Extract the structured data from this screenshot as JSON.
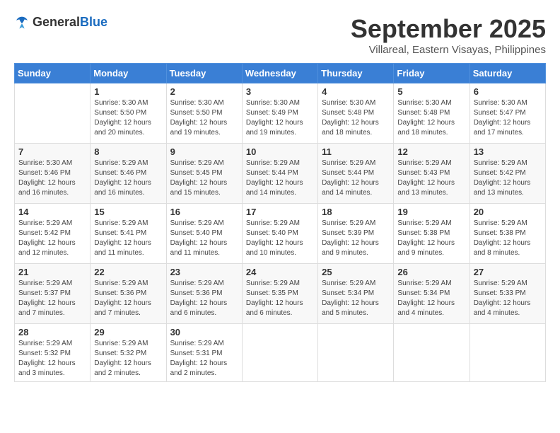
{
  "logo": {
    "text_general": "General",
    "text_blue": "Blue"
  },
  "header": {
    "month": "September 2025",
    "location": "Villareal, Eastern Visayas, Philippines"
  },
  "weekdays": [
    "Sunday",
    "Monday",
    "Tuesday",
    "Wednesday",
    "Thursday",
    "Friday",
    "Saturday"
  ],
  "weeks": [
    [
      {
        "day": "",
        "sunrise": "",
        "sunset": "",
        "daylight": ""
      },
      {
        "day": "1",
        "sunrise": "Sunrise: 5:30 AM",
        "sunset": "Sunset: 5:50 PM",
        "daylight": "Daylight: 12 hours and 20 minutes."
      },
      {
        "day": "2",
        "sunrise": "Sunrise: 5:30 AM",
        "sunset": "Sunset: 5:50 PM",
        "daylight": "Daylight: 12 hours and 19 minutes."
      },
      {
        "day": "3",
        "sunrise": "Sunrise: 5:30 AM",
        "sunset": "Sunset: 5:49 PM",
        "daylight": "Daylight: 12 hours and 19 minutes."
      },
      {
        "day": "4",
        "sunrise": "Sunrise: 5:30 AM",
        "sunset": "Sunset: 5:48 PM",
        "daylight": "Daylight: 12 hours and 18 minutes."
      },
      {
        "day": "5",
        "sunrise": "Sunrise: 5:30 AM",
        "sunset": "Sunset: 5:48 PM",
        "daylight": "Daylight: 12 hours and 18 minutes."
      },
      {
        "day": "6",
        "sunrise": "Sunrise: 5:30 AM",
        "sunset": "Sunset: 5:47 PM",
        "daylight": "Daylight: 12 hours and 17 minutes."
      }
    ],
    [
      {
        "day": "7",
        "sunrise": "Sunrise: 5:30 AM",
        "sunset": "Sunset: 5:46 PM",
        "daylight": "Daylight: 12 hours and 16 minutes."
      },
      {
        "day": "8",
        "sunrise": "Sunrise: 5:29 AM",
        "sunset": "Sunset: 5:46 PM",
        "daylight": "Daylight: 12 hours and 16 minutes."
      },
      {
        "day": "9",
        "sunrise": "Sunrise: 5:29 AM",
        "sunset": "Sunset: 5:45 PM",
        "daylight": "Daylight: 12 hours and 15 minutes."
      },
      {
        "day": "10",
        "sunrise": "Sunrise: 5:29 AM",
        "sunset": "Sunset: 5:44 PM",
        "daylight": "Daylight: 12 hours and 14 minutes."
      },
      {
        "day": "11",
        "sunrise": "Sunrise: 5:29 AM",
        "sunset": "Sunset: 5:44 PM",
        "daylight": "Daylight: 12 hours and 14 minutes."
      },
      {
        "day": "12",
        "sunrise": "Sunrise: 5:29 AM",
        "sunset": "Sunset: 5:43 PM",
        "daylight": "Daylight: 12 hours and 13 minutes."
      },
      {
        "day": "13",
        "sunrise": "Sunrise: 5:29 AM",
        "sunset": "Sunset: 5:42 PM",
        "daylight": "Daylight: 12 hours and 13 minutes."
      }
    ],
    [
      {
        "day": "14",
        "sunrise": "Sunrise: 5:29 AM",
        "sunset": "Sunset: 5:42 PM",
        "daylight": "Daylight: 12 hours and 12 minutes."
      },
      {
        "day": "15",
        "sunrise": "Sunrise: 5:29 AM",
        "sunset": "Sunset: 5:41 PM",
        "daylight": "Daylight: 12 hours and 11 minutes."
      },
      {
        "day": "16",
        "sunrise": "Sunrise: 5:29 AM",
        "sunset": "Sunset: 5:40 PM",
        "daylight": "Daylight: 12 hours and 11 minutes."
      },
      {
        "day": "17",
        "sunrise": "Sunrise: 5:29 AM",
        "sunset": "Sunset: 5:40 PM",
        "daylight": "Daylight: 12 hours and 10 minutes."
      },
      {
        "day": "18",
        "sunrise": "Sunrise: 5:29 AM",
        "sunset": "Sunset: 5:39 PM",
        "daylight": "Daylight: 12 hours and 9 minutes."
      },
      {
        "day": "19",
        "sunrise": "Sunrise: 5:29 AM",
        "sunset": "Sunset: 5:38 PM",
        "daylight": "Daylight: 12 hours and 9 minutes."
      },
      {
        "day": "20",
        "sunrise": "Sunrise: 5:29 AM",
        "sunset": "Sunset: 5:38 PM",
        "daylight": "Daylight: 12 hours and 8 minutes."
      }
    ],
    [
      {
        "day": "21",
        "sunrise": "Sunrise: 5:29 AM",
        "sunset": "Sunset: 5:37 PM",
        "daylight": "Daylight: 12 hours and 7 minutes."
      },
      {
        "day": "22",
        "sunrise": "Sunrise: 5:29 AM",
        "sunset": "Sunset: 5:36 PM",
        "daylight": "Daylight: 12 hours and 7 minutes."
      },
      {
        "day": "23",
        "sunrise": "Sunrise: 5:29 AM",
        "sunset": "Sunset: 5:36 PM",
        "daylight": "Daylight: 12 hours and 6 minutes."
      },
      {
        "day": "24",
        "sunrise": "Sunrise: 5:29 AM",
        "sunset": "Sunset: 5:35 PM",
        "daylight": "Daylight: 12 hours and 6 minutes."
      },
      {
        "day": "25",
        "sunrise": "Sunrise: 5:29 AM",
        "sunset": "Sunset: 5:34 PM",
        "daylight": "Daylight: 12 hours and 5 minutes."
      },
      {
        "day": "26",
        "sunrise": "Sunrise: 5:29 AM",
        "sunset": "Sunset: 5:34 PM",
        "daylight": "Daylight: 12 hours and 4 minutes."
      },
      {
        "day": "27",
        "sunrise": "Sunrise: 5:29 AM",
        "sunset": "Sunset: 5:33 PM",
        "daylight": "Daylight: 12 hours and 4 minutes."
      }
    ],
    [
      {
        "day": "28",
        "sunrise": "Sunrise: 5:29 AM",
        "sunset": "Sunset: 5:32 PM",
        "daylight": "Daylight: 12 hours and 3 minutes."
      },
      {
        "day": "29",
        "sunrise": "Sunrise: 5:29 AM",
        "sunset": "Sunset: 5:32 PM",
        "daylight": "Daylight: 12 hours and 2 minutes."
      },
      {
        "day": "30",
        "sunrise": "Sunrise: 5:29 AM",
        "sunset": "Sunset: 5:31 PM",
        "daylight": "Daylight: 12 hours and 2 minutes."
      },
      {
        "day": "",
        "sunrise": "",
        "sunset": "",
        "daylight": ""
      },
      {
        "day": "",
        "sunrise": "",
        "sunset": "",
        "daylight": ""
      },
      {
        "day": "",
        "sunrise": "",
        "sunset": "",
        "daylight": ""
      },
      {
        "day": "",
        "sunrise": "",
        "sunset": "",
        "daylight": ""
      }
    ]
  ]
}
